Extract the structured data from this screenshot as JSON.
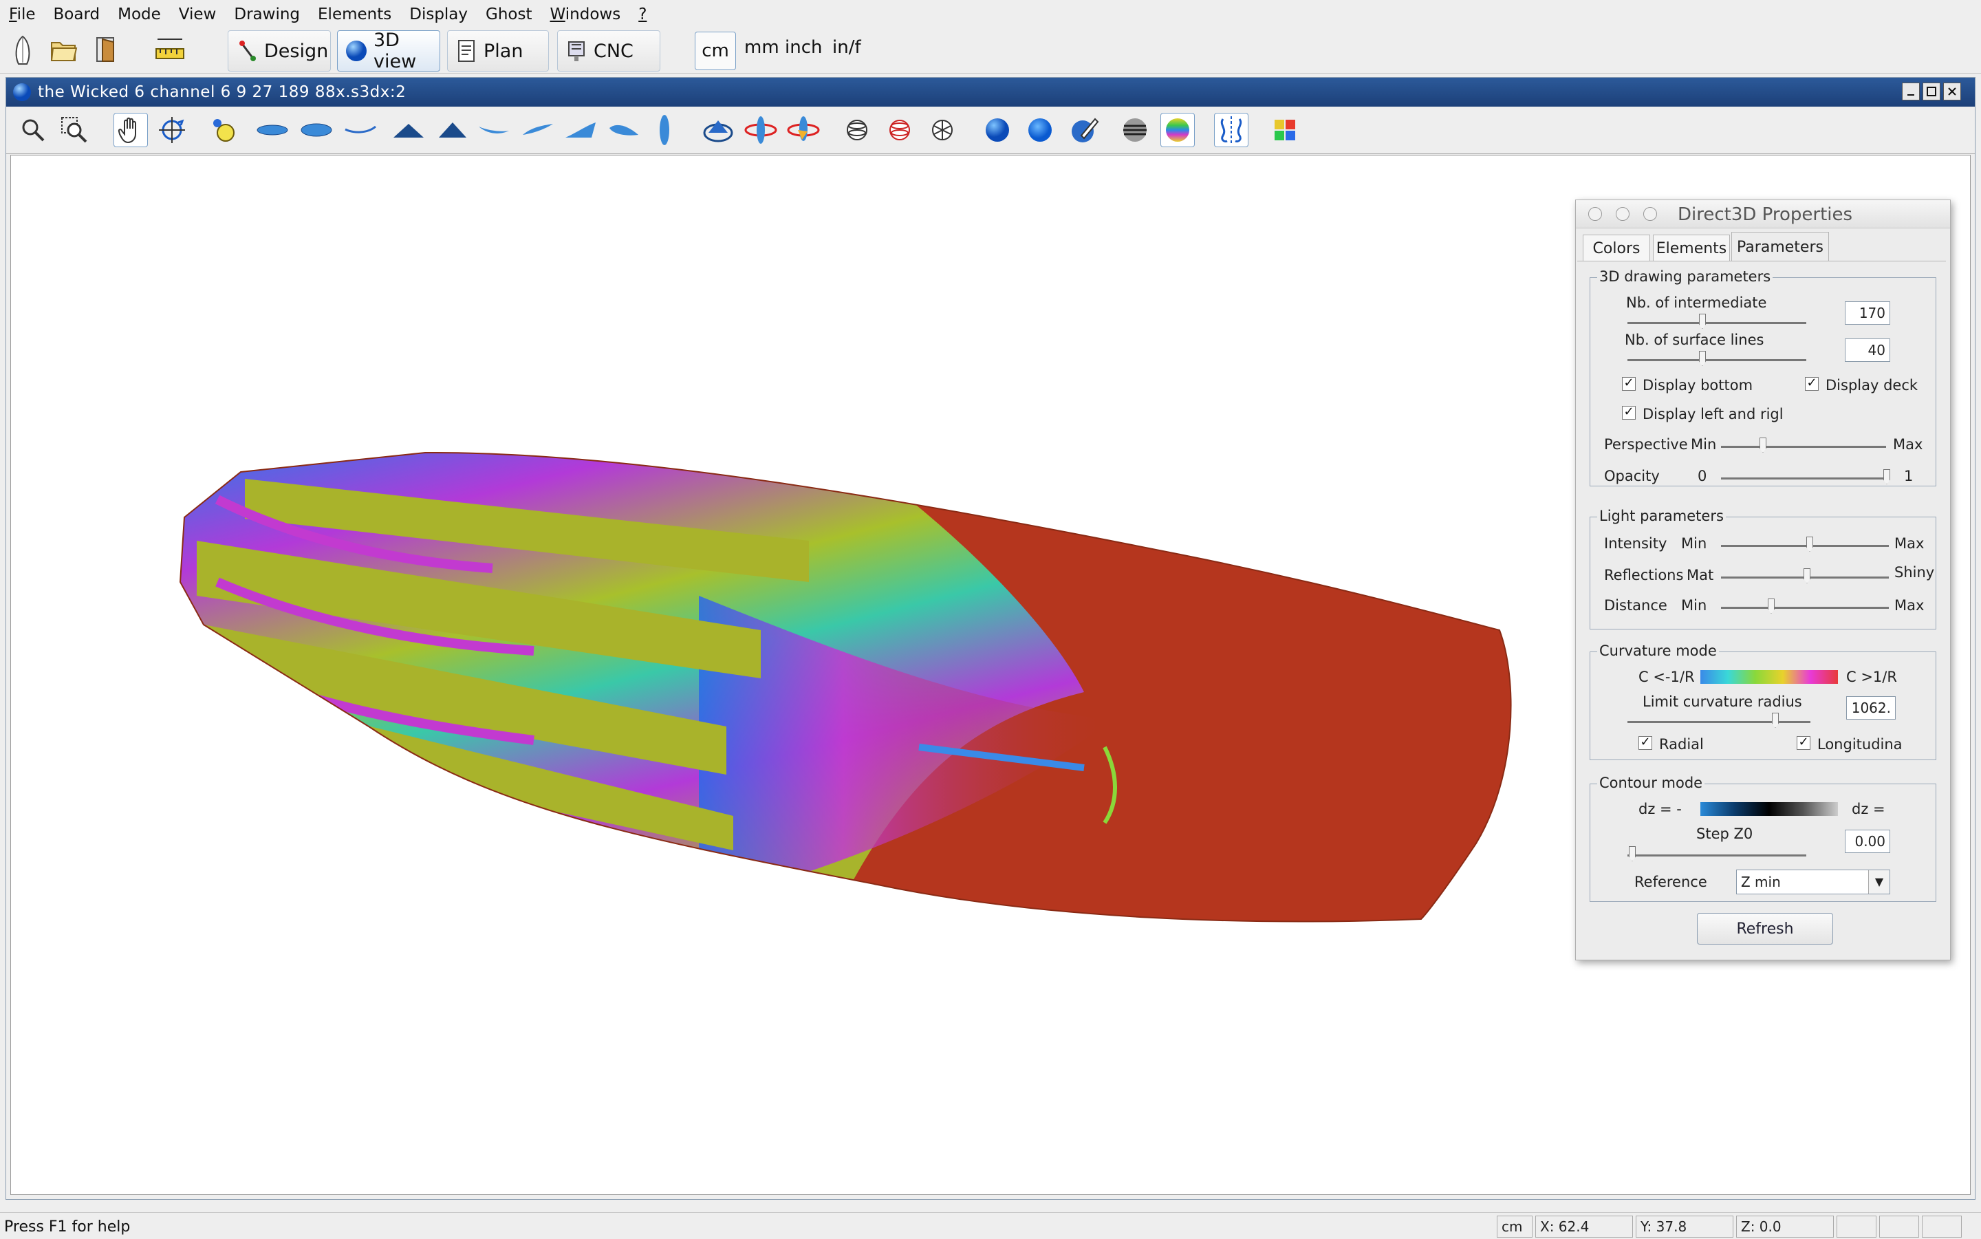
{
  "menubar": {
    "items": [
      {
        "label": "File",
        "u": "F",
        "rest": "ile"
      },
      {
        "label": "Board",
        "u": "",
        "rest": "Board"
      },
      {
        "label": "Mode",
        "u": "",
        "rest": "Mode"
      },
      {
        "label": "View",
        "u": "",
        "rest": "View"
      },
      {
        "label": "Drawing",
        "u": "",
        "rest": "Drawing"
      },
      {
        "label": "Elements",
        "u": "",
        "rest": "Elements"
      },
      {
        "label": "Display",
        "u": "",
        "rest": "Display"
      },
      {
        "label": "Ghost",
        "u": "",
        "rest": "Ghost"
      },
      {
        "label": "Windows",
        "u": "W",
        "rest": "indows"
      },
      {
        "label": "?",
        "u": "?",
        "rest": ""
      }
    ]
  },
  "toolbar": {
    "modes": {
      "design": "Design",
      "view3d": "3D view",
      "plan": "Plan",
      "cnc": "CNC"
    },
    "units": {
      "cm": "cm",
      "mm": "mm",
      "inch": "inch",
      "inf": "in/f"
    }
  },
  "frame": {
    "title": "the Wicked 6 channel 6 9 27 189 88x.s3dx:2"
  },
  "props": {
    "title": "Direct3D Properties",
    "tabs": {
      "colors": "Colors",
      "elements": "Elements",
      "parameters": "Parameters"
    },
    "drawing": {
      "title": "3D drawing parameters",
      "intermediate_label": "Nb. of intermediate",
      "intermediate_value": "170",
      "surface_label": "Nb. of surface lines",
      "surface_value": "40",
      "display_bottom": "Display bottom",
      "display_deck": "Display deck",
      "display_lr": "Display left and rigl",
      "perspective": "Perspective",
      "persp_min": "Min",
      "persp_max": "Max",
      "opacity": "Opacity",
      "op_min": "0",
      "op_max": "1"
    },
    "light": {
      "title": "Light parameters",
      "intensity": "Intensity",
      "int_min": "Min",
      "int_max": "Max",
      "reflections": "Reflections",
      "ref_min": "Mat",
      "ref_max": "Shiny",
      "distance": "Distance",
      "dist_min": "Min",
      "dist_max": "Max"
    },
    "curvature": {
      "title": "Curvature mode",
      "left": "C <-1/R",
      "right": "C >1/R",
      "limit_label": "Limit curvature radius",
      "limit_value": "1062.",
      "radial": "Radial",
      "longitudinal": "Longitudina"
    },
    "contour": {
      "title": "Contour mode",
      "left": "dz = -",
      "right": "dz =",
      "step_label": "Step Z0",
      "step_value": "0.00",
      "reference_label": "Reference",
      "reference_value": "Z min"
    },
    "refresh": "Refresh"
  },
  "status": {
    "help": "Press F1 for help",
    "unit": "cm",
    "x": "X: 62.4",
    "y": "Y: 37.8",
    "z": "Z: 0.0"
  }
}
